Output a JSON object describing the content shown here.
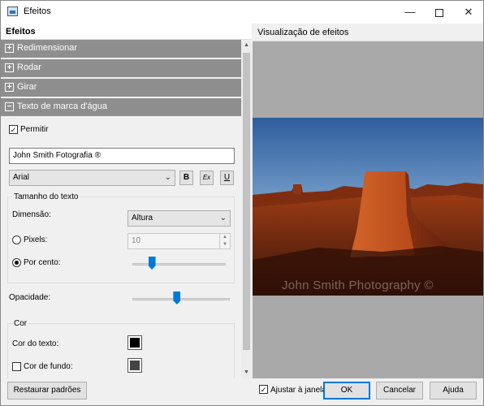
{
  "window": {
    "title": "Efeitos",
    "minimize_glyph": "—",
    "close_glyph": "✕"
  },
  "left_panel": {
    "header": "Efeitos",
    "sections": [
      {
        "label": "Redimensionar",
        "glyph": "+"
      },
      {
        "label": "Rodar",
        "glyph": "+"
      },
      {
        "label": "Girar",
        "glyph": "+"
      },
      {
        "label": "Texto de marca d'água",
        "glyph": "−"
      }
    ],
    "permitir": {
      "label": "Permitir",
      "checked": true,
      "check_glyph": "✓"
    },
    "watermark_text": "John Smith Fotografia ®",
    "font": {
      "value": "Arial",
      "arrow": "⌄",
      "bold": "B",
      "italic": "Ex",
      "underline": "U"
    },
    "text_size": {
      "title": "Tamanho do texto",
      "dimension_label": "Dimensão:",
      "dimension_value": "Altura",
      "pixels_label": "Pixels:",
      "pixels_value": "10",
      "percent_label": "Por cento:",
      "percent_slider_level": 0.17,
      "selected": "percent"
    },
    "opacity": {
      "label": "Opacidade:",
      "level": 0.42
    },
    "color": {
      "title": "Cor",
      "text_color_label": "Cor do texto:",
      "text_color": "#000000",
      "background_label": "Cor de fundo:",
      "background_checked": false,
      "background_color": "#444444"
    }
  },
  "preview": {
    "header": "Visualização de efeitos",
    "watermark": "John Smith Photography ©"
  },
  "footer": {
    "restore": "Restaurar padrões",
    "fit_label": "Ajustar à janela",
    "fit_checked": true,
    "ok": "OK",
    "cancel": "Cancelar",
    "help": "Ajuda"
  }
}
